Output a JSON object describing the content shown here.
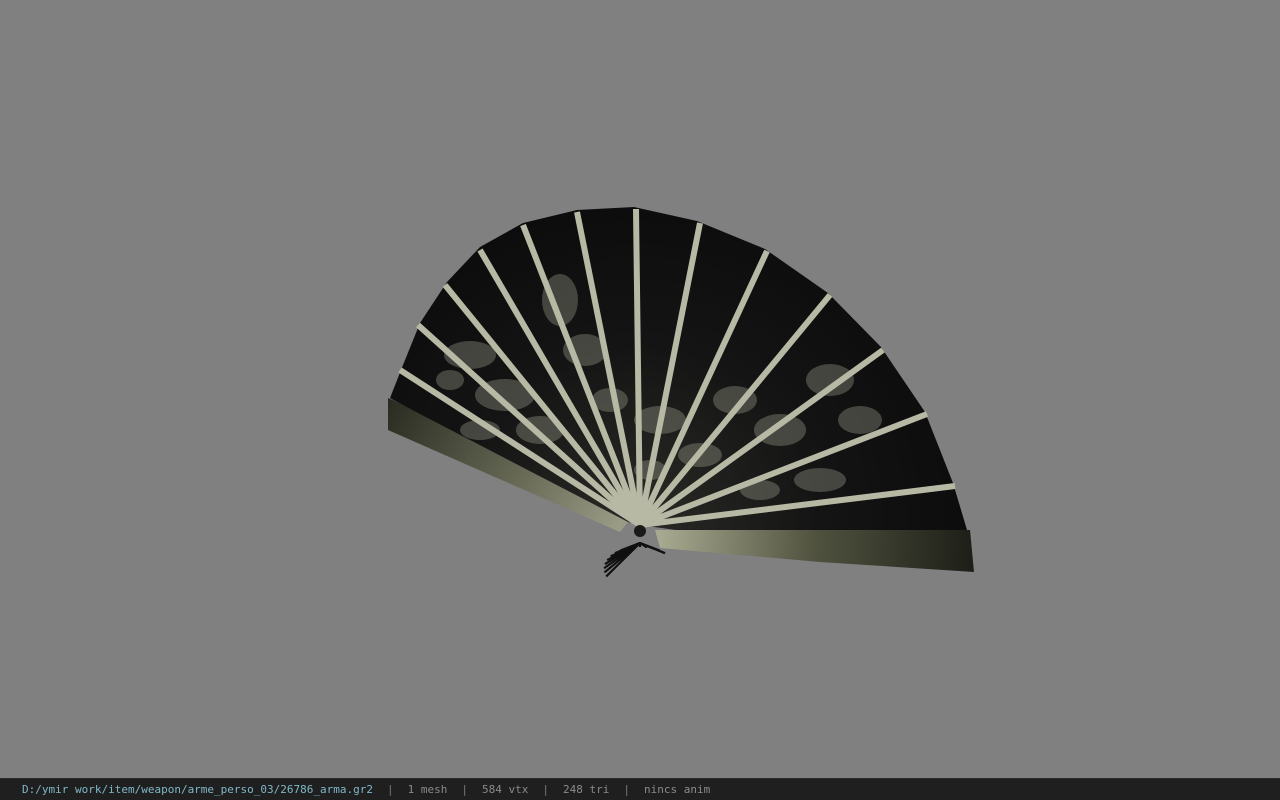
{
  "viewer": {
    "background_color": "#808080",
    "model": {
      "name": "fan",
      "paper_color": "#121212",
      "rib_color": "#b8b9a4",
      "pattern_color": "#c8ccb4"
    }
  },
  "status_bar": {
    "file_path": "D:/ymir work/item/weapon/arme_perso_03/26786_arma.gr2",
    "separator": "|",
    "mesh_count": "1 mesh",
    "vertex_count": "584 vtx",
    "triangle_count": "248 tri",
    "animation": "nincs anim"
  }
}
